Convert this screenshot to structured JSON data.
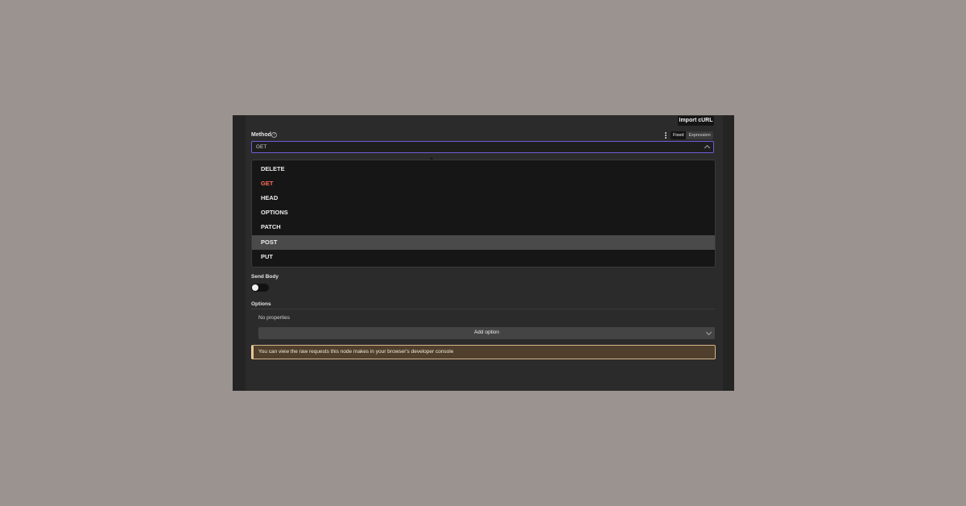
{
  "header": {
    "import_curl_label": "Import cURL"
  },
  "method": {
    "label": "Method",
    "help_icon": "?",
    "mode_fixed": "Fixed",
    "mode_expression": "Expression",
    "selected_value": "GET",
    "options": [
      "DELETE",
      "GET",
      "HEAD",
      "OPTIONS",
      "PATCH",
      "POST",
      "PUT"
    ],
    "selected_option": "GET",
    "hovered_option": "POST"
  },
  "send_body": {
    "label": "Send Body",
    "enabled": false
  },
  "options_section": {
    "label": "Options",
    "empty_text": "No properties",
    "add_option_label": "Add option"
  },
  "notice": {
    "text": "You can view the raw requests this node makes in your browser's developer console"
  },
  "colors": {
    "accent_border": "#6f5bd6",
    "selected_option": "#ff6f5c",
    "notice_bg": "#4f3f2c",
    "notice_border": "#d9b58a"
  },
  "icons": [
    "help-icon",
    "kebab-icon",
    "chevron-up-icon",
    "chevron-down-icon"
  ]
}
